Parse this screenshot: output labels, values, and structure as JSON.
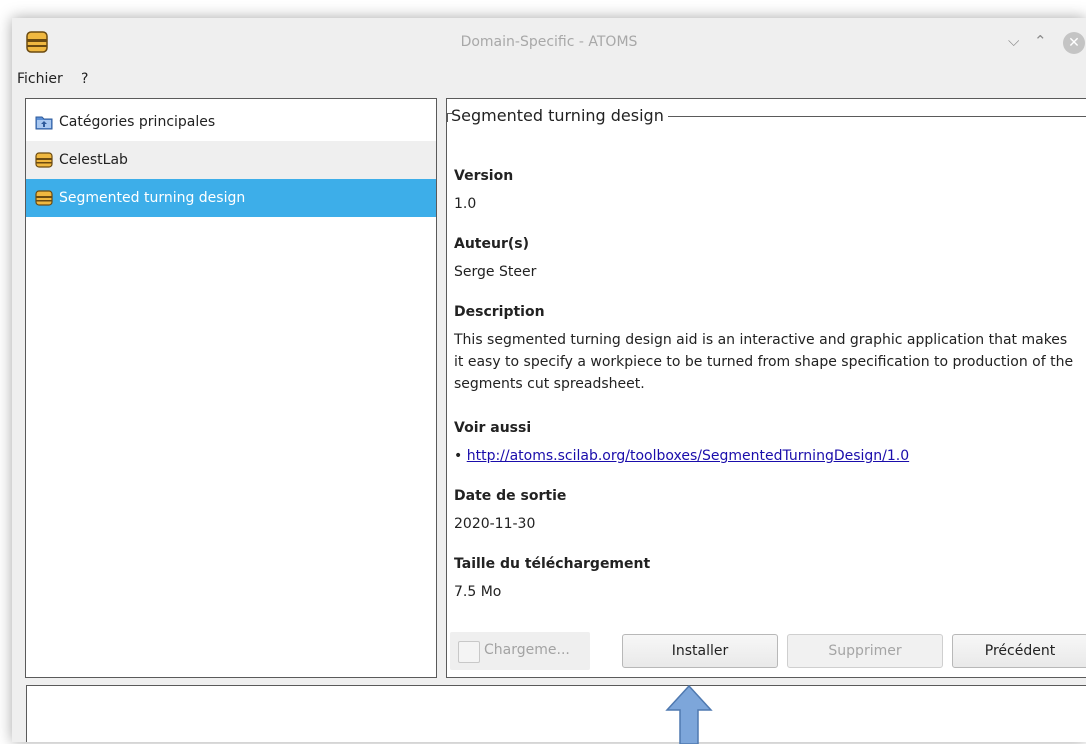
{
  "window": {
    "title": "Domain-Specific - ATOMS",
    "app_icon": "toolbox-icon",
    "controls": {
      "minimize": "⌵",
      "maximize": "⌃",
      "close": "✕"
    }
  },
  "menu": {
    "fichier": "Fichier",
    "help": "?"
  },
  "tree": {
    "items": [
      {
        "label": "Catégories principales",
        "icon": "folder-up-icon"
      },
      {
        "label": "CelestLab",
        "icon": "toolbox-icon"
      },
      {
        "label": "Segmented turning design",
        "icon": "toolbox-icon",
        "selected": true
      }
    ]
  },
  "details": {
    "title": "Segmented turning design",
    "version_label": "Version",
    "version": "1.0",
    "authors_label": "Auteur(s)",
    "authors": "Serge Steer",
    "description_label": "Description",
    "description": "This segmented turning design aid is an interactive and graphic application that makes it easy to specify a workpiece to be turned from shape specification to production of the segments cut spreadsheet.",
    "see_also_label": "Voir aussi",
    "see_also_bullet": "•",
    "see_also_link": "http://atoms.scilab.org/toolboxes/SegmentedTurningDesign/1.0",
    "release_label": "Date de sortie",
    "release_date": "2020-11-30",
    "size_label": "Taille du téléchargement",
    "size": "7.5 Mo"
  },
  "buttons": {
    "load_checkbox": "Chargeme...",
    "install": "Installer",
    "remove": "Supprimer",
    "previous": "Précédent"
  },
  "colors": {
    "selection": "#3daee9",
    "arrow": "#7da6da",
    "link": "#1a0dab"
  }
}
